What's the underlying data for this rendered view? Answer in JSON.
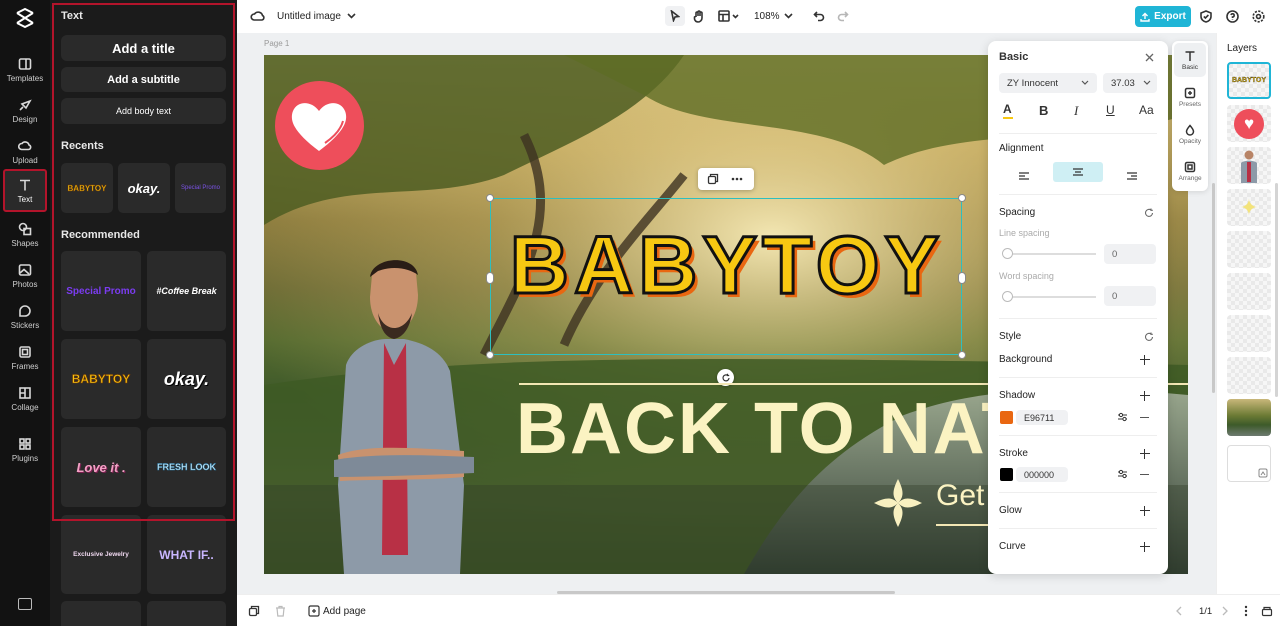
{
  "rail": {
    "items": [
      {
        "label": "Templates",
        "icon": "templates-icon"
      },
      {
        "label": "Design",
        "icon": "design-icon"
      },
      {
        "label": "Upload",
        "icon": "upload-icon"
      },
      {
        "label": "Text",
        "icon": "text-icon"
      },
      {
        "label": "Shapes",
        "icon": "shapes-icon"
      },
      {
        "label": "Photos",
        "icon": "photos-icon"
      },
      {
        "label": "Stickers",
        "icon": "stickers-icon"
      },
      {
        "label": "Frames",
        "icon": "frames-icon"
      },
      {
        "label": "Collage",
        "icon": "collage-icon"
      },
      {
        "label": "Plugins",
        "icon": "plugins-icon"
      }
    ],
    "active": "Text"
  },
  "panel": {
    "title": "Text",
    "add_title": "Add a title",
    "add_subtitle": "Add a subtitle",
    "add_body": "Add body text",
    "recents_heading": "Recents",
    "recents": [
      "BABYTOY",
      "okay.",
      "Special Promo"
    ],
    "recommended_heading": "Recommended",
    "recommended": [
      "Special Promo",
      "#Coffee Break",
      "BABYTOY",
      "okay.",
      "Love it .",
      "FRESH LOOK",
      "Exclusive Jewelry",
      "WHAT IF.."
    ]
  },
  "topbar": {
    "doc_title": "Untitled image",
    "zoom": "108%",
    "export_label": "Export"
  },
  "canvas": {
    "page_label": "Page 1",
    "headline": "BABYTOY",
    "subheadline": "BACK TO NAT",
    "tagline": "Get"
  },
  "props": {
    "header": "Basic",
    "font_name": "ZY Innocent",
    "font_size": "37.03",
    "alignment_label": "Alignment",
    "spacing_label": "Spacing",
    "line_spacing_label": "Line spacing",
    "line_spacing_value": "0",
    "word_spacing_label": "Word spacing",
    "word_spacing_value": "0",
    "style_label": "Style",
    "background_label": "Background",
    "shadow_label": "Shadow",
    "shadow_color": "E96711",
    "stroke_label": "Stroke",
    "stroke_color": "000000",
    "glow_label": "Glow",
    "curve_label": "Curve"
  },
  "side_tabs": [
    "Basic",
    "Presets",
    "Opacity",
    "Arrange"
  ],
  "layers": {
    "title": "Layers"
  },
  "bottombar": {
    "add_page": "Add page",
    "pages": "1/1"
  },
  "colors": {
    "accent": "#1fb5d6",
    "highlight": "#b3142b",
    "shadow_swatch": "#E96711",
    "stroke_swatch": "#000000",
    "headline_fill": "#f7c812"
  }
}
